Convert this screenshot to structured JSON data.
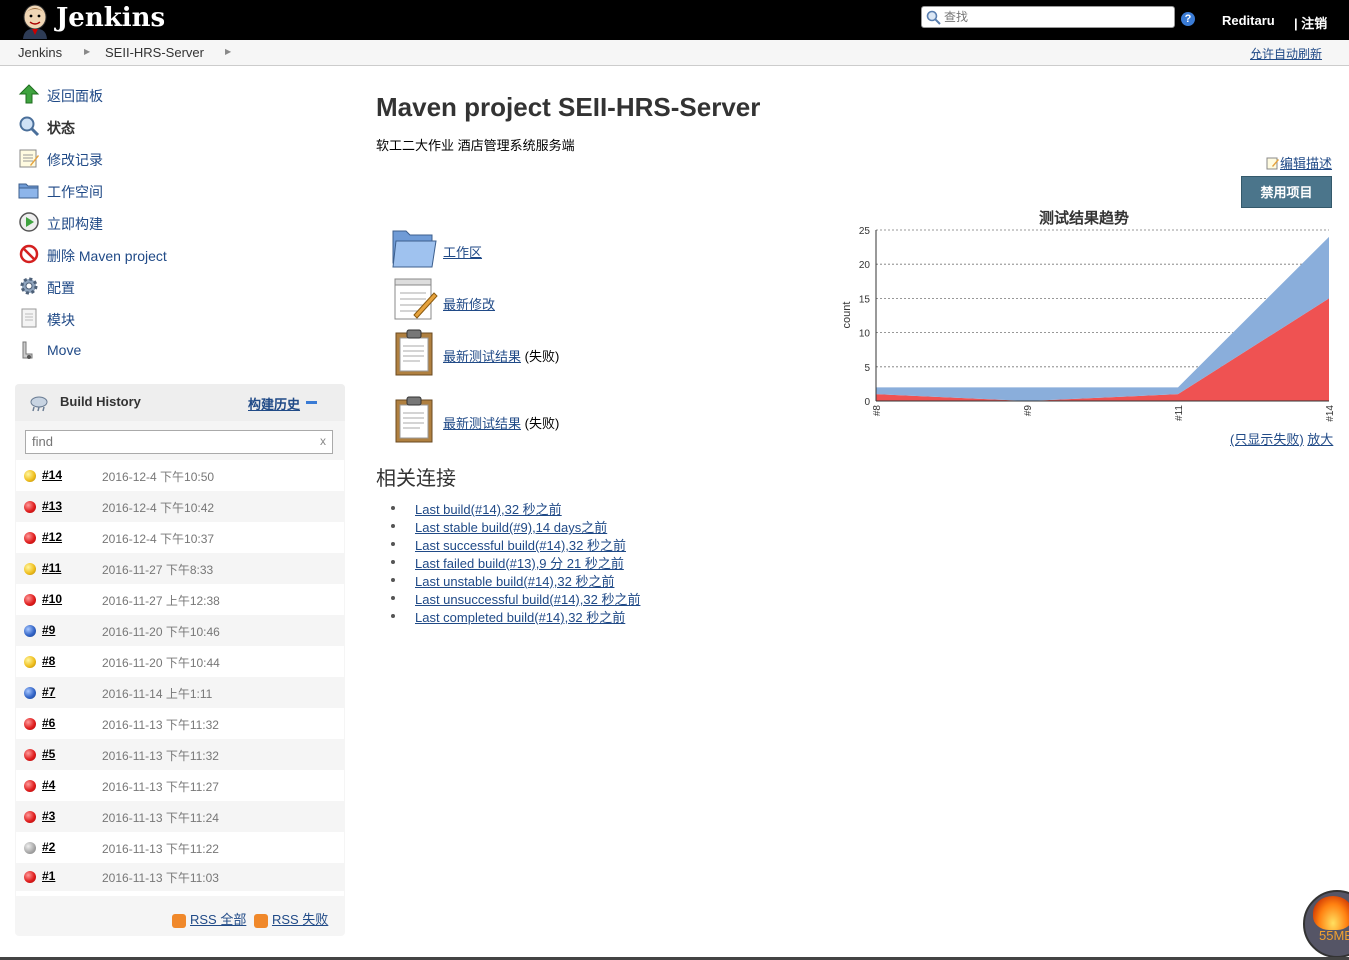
{
  "header": {
    "app_name": "Jenkins",
    "search_placeholder": "查找",
    "help": "?",
    "user": "Reditaru",
    "logout": "| 注销"
  },
  "breadcrumb": {
    "items": [
      "Jenkins",
      "SEII-HRS-Server"
    ],
    "auto_refresh": "允许自动刷新"
  },
  "sidebar": {
    "tasks": [
      {
        "label": "返回面板"
      },
      {
        "label": "状态"
      },
      {
        "label": "修改记录"
      },
      {
        "label": "工作空间"
      },
      {
        "label": "立即构建"
      },
      {
        "label": "删除 Maven project"
      },
      {
        "label": "配置"
      },
      {
        "label": "模块"
      },
      {
        "label": "Move"
      }
    ]
  },
  "build_history": {
    "title": "Build History",
    "link": "构建历史",
    "find_placeholder": "find",
    "clear": "x",
    "builds": [
      {
        "num": "#14",
        "date": "2016-12-4 下午10:50",
        "status": "yellow"
      },
      {
        "num": "#13",
        "date": "2016-12-4 下午10:42",
        "status": "red"
      },
      {
        "num": "#12",
        "date": "2016-12-4 下午10:37",
        "status": "red"
      },
      {
        "num": "#11",
        "date": "2016-11-27 下午8:33",
        "status": "yellow"
      },
      {
        "num": "#10",
        "date": "2016-11-27 上午12:38",
        "status": "red"
      },
      {
        "num": "#9",
        "date": "2016-11-20 下午10:46",
        "status": "blue"
      },
      {
        "num": "#8",
        "date": "2016-11-20 下午10:44",
        "status": "yellow"
      },
      {
        "num": "#7",
        "date": "2016-11-14 上午1:11",
        "status": "blue"
      },
      {
        "num": "#6",
        "date": "2016-11-13 下午11:32",
        "status": "red"
      },
      {
        "num": "#5",
        "date": "2016-11-13 下午11:32",
        "status": "red"
      },
      {
        "num": "#4",
        "date": "2016-11-13 下午11:27",
        "status": "red"
      },
      {
        "num": "#3",
        "date": "2016-11-13 下午11:24",
        "status": "red"
      },
      {
        "num": "#2",
        "date": "2016-11-13 下午11:22",
        "status": "grey"
      },
      {
        "num": "#1",
        "date": "2016-11-13 下午11:03",
        "status": "red"
      }
    ],
    "rss_all": "RSS 全部",
    "rss_failed": "RSS 失败"
  },
  "main": {
    "title": "Maven project SEII-HRS-Server",
    "description": "软工二大作业 酒店管理系统服务端",
    "edit_description": "编辑描述",
    "disable_button": "禁用项目",
    "links": [
      {
        "label": "工作区",
        "suffix": ""
      },
      {
        "label": "最新修改",
        "suffix": ""
      },
      {
        "label": "最新测试结果",
        "suffix": " (失败)"
      },
      {
        "label": "最新测试结果",
        "suffix": " (失败)"
      }
    ],
    "related_title": "相关连接",
    "related": [
      "Last build(#14),32 秒之前",
      "Last stable build(#9),14 days之前",
      "Last successful build(#14),32 秒之前",
      "Last failed build(#13),9 分 21 秒之前",
      "Last unstable build(#14),32 秒之前",
      "Last unsuccessful build(#14),32 秒之前",
      "Last completed build(#14),32 秒之前"
    ]
  },
  "chart_links": {
    "only_failures": "(只显示失败)",
    "zoom": "放大"
  },
  "memory_badge": "55MB",
  "chart_data": {
    "type": "area",
    "title": "测试结果趋势",
    "ylabel": "count",
    "xlabel": "",
    "categories": [
      "#8",
      "#9",
      "#11",
      "#14"
    ],
    "ylim": [
      0,
      25
    ],
    "yticks": [
      0,
      5,
      10,
      15,
      20,
      25
    ],
    "series": [
      {
        "values": [
          1,
          0,
          1,
          15
        ],
        "color": "#ef5252"
      },
      {
        "values": [
          1,
          2,
          1,
          9
        ],
        "color": "#8aaedb"
      }
    ]
  }
}
